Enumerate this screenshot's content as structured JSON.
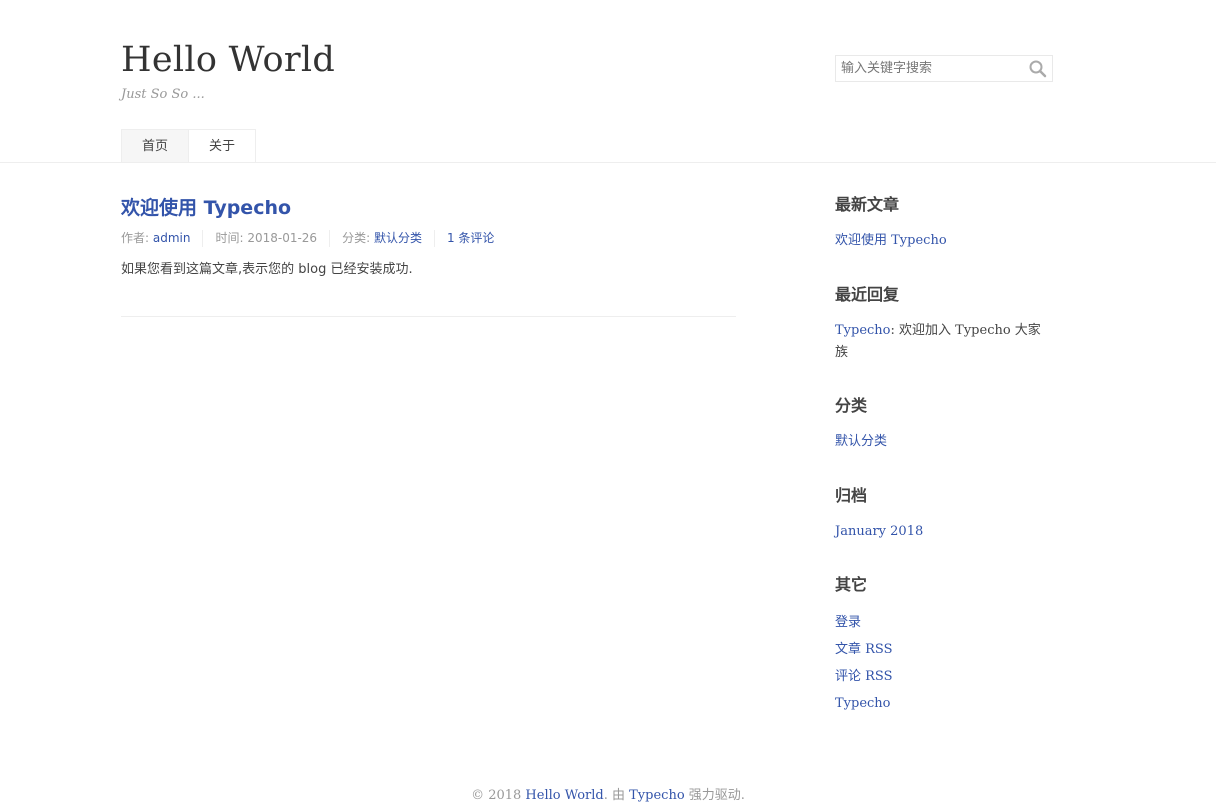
{
  "header": {
    "site_title": "Hello World",
    "site_description": "Just So So ...",
    "search_placeholder": "输入关键字搜索"
  },
  "nav": {
    "items": [
      {
        "label": "首页",
        "current": true
      },
      {
        "label": "关于",
        "current": false
      }
    ]
  },
  "post": {
    "title": "欢迎使用 Typecho",
    "meta": {
      "author_label": "作者: ",
      "author": "admin",
      "time_label": "时间: 2018-01-26",
      "category_label": "分类: ",
      "category": "默认分类",
      "comments": "1 条评论"
    },
    "content": "如果您看到这篇文章,表示您的 blog 已经安装成功."
  },
  "sidebar": {
    "recent_posts": {
      "title": "最新文章",
      "items": [
        "欢迎使用 Typecho"
      ]
    },
    "recent_comments": {
      "title": "最近回复",
      "author": "Typecho",
      "text": ": 欢迎加入 Typecho 大家族"
    },
    "categories": {
      "title": "分类",
      "items": [
        "默认分类"
      ]
    },
    "archives": {
      "title": "归档",
      "items": [
        "January 2018"
      ]
    },
    "misc": {
      "title": "其它",
      "items": [
        "登录",
        "文章 RSS",
        "评论 RSS",
        "Typecho"
      ]
    }
  },
  "footer": {
    "prefix": "© 2018 ",
    "site_link": "Hello World",
    "middle": ". 由 ",
    "typecho_link": "Typecho",
    "suffix": " 强力驱动."
  },
  "colors": {
    "link": "#3354AA",
    "text": "#444444",
    "muted": "#999999",
    "border": "#eeeeee"
  }
}
